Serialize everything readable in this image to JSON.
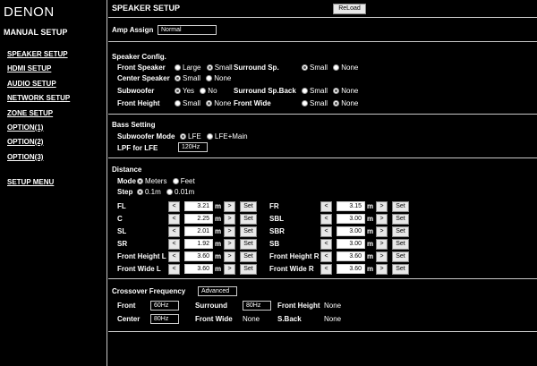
{
  "logo": "DENON",
  "manual_setup": "MANUAL SETUP",
  "nav": [
    "SPEAKER SETUP",
    "HDMI SETUP",
    "AUDIO SETUP",
    "NETWORK SETUP",
    "ZONE SETUP",
    "OPTION(1)",
    "OPTION(2)",
    "OPTION(3)",
    "SETUP MENU"
  ],
  "header": {
    "title": "SPEAKER SETUP",
    "reload": "ReLoad"
  },
  "amp": {
    "label": "Amp Assign",
    "value": "Normal"
  },
  "config": {
    "title": "Speaker Config.",
    "front_speaker": "Front Speaker",
    "large": "Large",
    "small": "Small",
    "center_speaker": "Center Speaker",
    "none": "None",
    "subwoofer": "Subwoofer",
    "yes": "Yes",
    "no": "No",
    "front_height": "Front Height",
    "surround_sp": "Surround Sp.",
    "surround_sp_back": "Surround Sp.Back",
    "front_wide": "Front Wide"
  },
  "bass": {
    "title": "Bass Setting",
    "mode_label": "Subwoofer Mode",
    "lfe": "LFE",
    "lfe_main": "LFE+Main",
    "lpf_label": "LPF for LFE",
    "lpf_value": "120Hz"
  },
  "distance": {
    "title": "Distance",
    "mode_label": "Mode",
    "meters": "Meters",
    "feet": "Feet",
    "step_label": "Step",
    "step1": "0.1m",
    "step2": "0.01m",
    "lt": "<",
    "gt": ">",
    "set": "Set",
    "unit": "m",
    "left": [
      {
        "label": "FL",
        "value": "3.21"
      },
      {
        "label": "C",
        "value": "2.25"
      },
      {
        "label": "SL",
        "value": "2.01"
      },
      {
        "label": "SR",
        "value": "1.92"
      },
      {
        "label": "Front Height L",
        "value": "3.60"
      },
      {
        "label": "Front Wide L",
        "value": "3.60"
      }
    ],
    "right": [
      {
        "label": "FR",
        "value": "3.15"
      },
      {
        "label": "SBL",
        "value": "3.00"
      },
      {
        "label": "SBR",
        "value": "3.00"
      },
      {
        "label": "SB",
        "value": "3.00"
      },
      {
        "label": "Front Height R",
        "value": "3.60"
      },
      {
        "label": "Front Wide R",
        "value": "3.60"
      }
    ]
  },
  "crossover": {
    "title": "Crossover Frequency",
    "mode": "Advanced",
    "front": "Front",
    "front_value": "60Hz",
    "surround": "Surround",
    "surround_value": "80Hz",
    "front_height": "Front Height",
    "front_height_value": "None",
    "center": "Center",
    "center_value": "80Hz",
    "front_wide": "Front Wide",
    "front_wide_value": "None",
    "sback": "S.Back",
    "sback_value": "None"
  }
}
